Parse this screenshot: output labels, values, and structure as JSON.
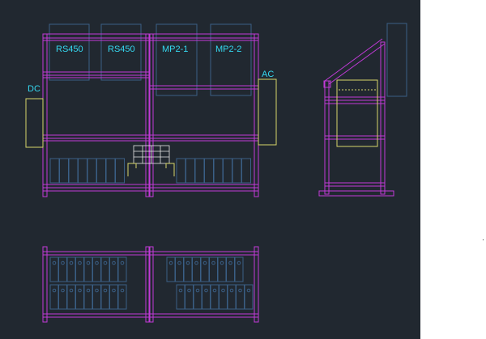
{
  "drawing": {
    "labels": {
      "rs450_a": "RS450",
      "rs450_b": "RS450",
      "mp2_1": "MP2-1",
      "mp2_2": "MP2-2",
      "dc": "DC",
      "ac": "AC"
    },
    "colors": {
      "background": "#212830",
      "frame": "#c23ad8",
      "blue": "#3a5f86",
      "yellow": "#d8d66a",
      "label": "#35d8f0",
      "white": "#e6e6e6"
    }
  },
  "side_panel": {
    "tick": "."
  }
}
